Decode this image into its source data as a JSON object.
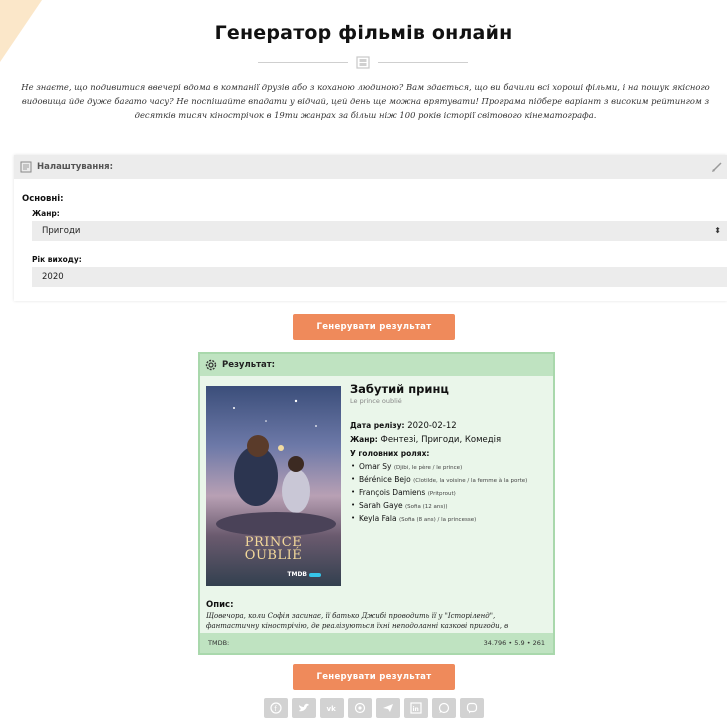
{
  "page": {
    "title": "Генератор фільмів онлайн",
    "intro": "Не знаєте, що подивитися ввечері вдома в компанії друзів або з коханою людиною? Вам здається, що ви бачили всі хороші фільми, і на пошук якісного видовища йде дуже багато часу? Не поспішайте впадати у відчай, цей день ще можна врятувати! Програма підбере варіант з високим рейтингом з десятків тисяч кінострічок в 19ти жанрах за більш ніж 100 років історії світового кінематографа."
  },
  "settings": {
    "header": "Налаштування:",
    "section": "Основні:",
    "genre_label": "Жанр:",
    "genre_value": "Пригоди",
    "year_label": "Рік виходу:",
    "year_value": "2020"
  },
  "generate_label": "Генерувати результат",
  "result": {
    "header": "Результат:",
    "poster_title_line1": "PRINCE",
    "poster_title_line2": "OUBLIÉ",
    "poster_logo": "TMDB",
    "title": "Забутий принц",
    "original_title": "Le prince oublié",
    "release_label": "Дата релізу:",
    "release_value": "2020-02-12",
    "genre_label": "Жанр:",
    "genre_value": "Фентезі, Пригоди, Комедія",
    "cast_label": "У головних ролях:",
    "cast": [
      {
        "name": "Omar Sy",
        "role": "(Djibi, le père / le prince)"
      },
      {
        "name": "Bérénice Bejo",
        "role": "(Clotilde, la voisine / la femme à la porte)"
      },
      {
        "name": "François Damiens",
        "role": "(Pritprout)"
      },
      {
        "name": "Sarah Gaye",
        "role": "(Sofia (12 ans))"
      },
      {
        "name": "Keyla Fala",
        "role": "(Sofia (8 ans) / la princesse)"
      }
    ],
    "desc_label": "Опис:",
    "description": "Щовечора, коли Софія засинає, її батько Джибі проводить її у \"Історіленд\", фантастичну кінострічію, де реалізуються їхні неподоланні казкові пригоди, в",
    "footer_source": "TMDB:",
    "footer_stats": "34.796 • 5.9 • 261"
  },
  "colors": {
    "accent": "#ef8a5b",
    "result_bg": "#eaf6ea",
    "result_border": "#a9d8ac",
    "corner": "#fbe7c9"
  },
  "share_icons": [
    "facebook-icon",
    "twitter-icon",
    "vk-icon",
    "odnoklassniki-icon",
    "telegram-icon",
    "linkedin-icon",
    "whatsapp-icon",
    "viber-icon"
  ]
}
